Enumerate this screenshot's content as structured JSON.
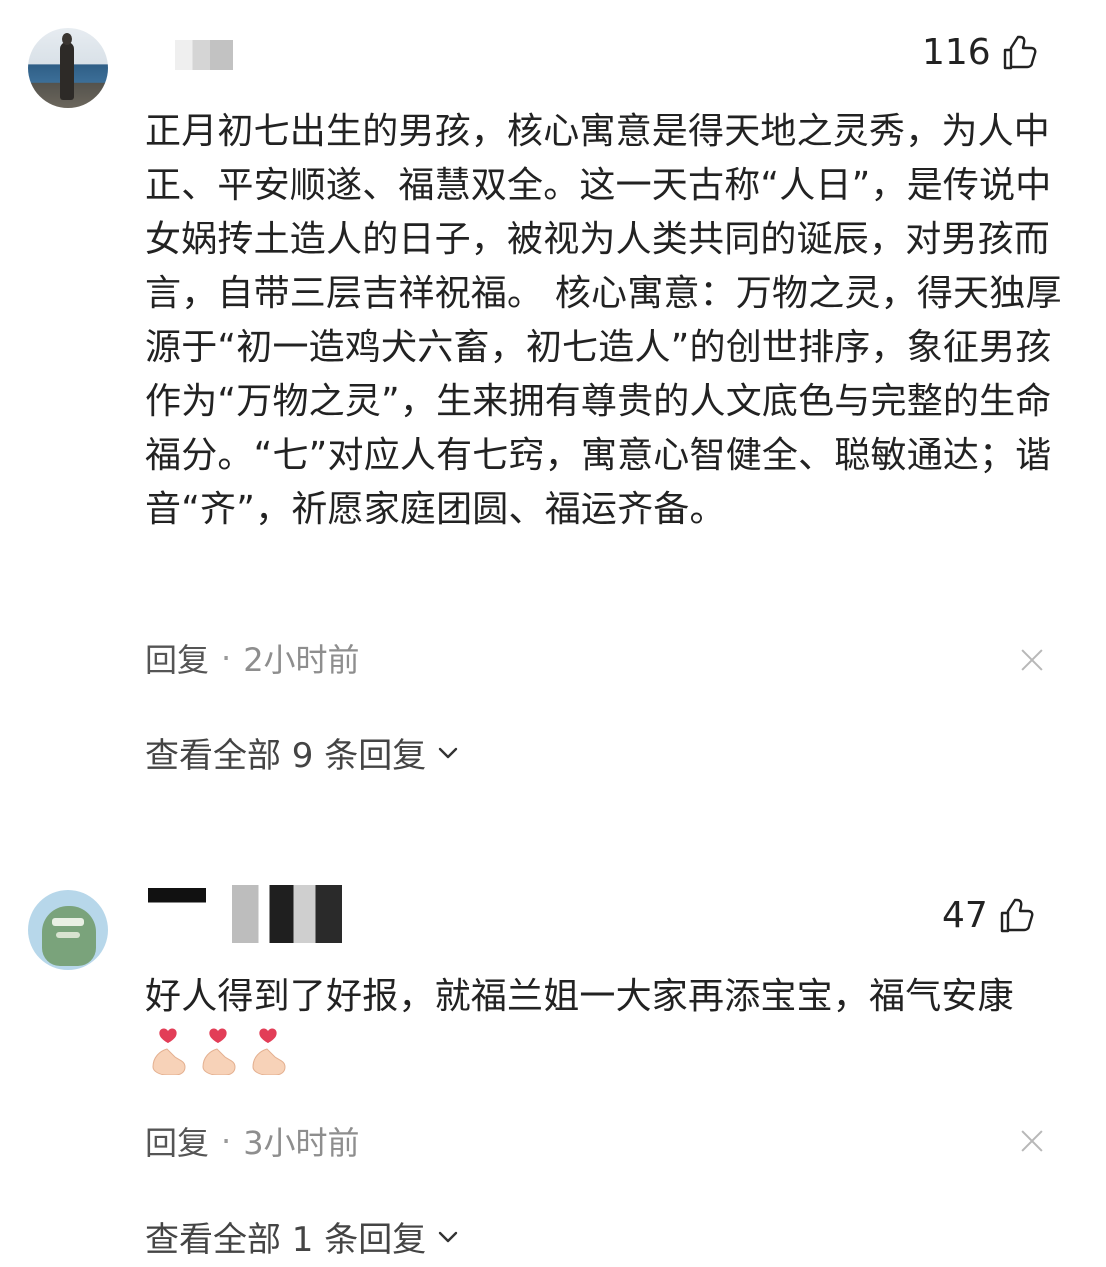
{
  "comments": [
    {
      "likes": "116",
      "text": "正月初七出生的男孩，核心寓意是得天地之灵秀，为人中正、平安顺遂、福慧双全。这一天古称“人日”，是传说中女娲抟土造人的日子，被视为人类共同的诞辰，对男孩而言，自带三层吉祥祝福。 核心寓意：万物之灵，得天独厚 源于“初一造鸡犬六畜，初七造人”的创世排序，象征男孩作为“万物之灵”，生来拥有尊贵的人文底色与完整的生命福分。“七”对应人有七窍，寓意心智健全、聪敏通达；谐音“齐”，祈愿家庭团圆、福运齐备。",
      "reply_label": "回复",
      "separator": "·",
      "time": "2小时前",
      "view_replies": "查看全部 9 条回复",
      "avatar_icon": "avatar-person-icon",
      "like_icon": "thumbs-up-icon",
      "close_icon": "close-icon"
    },
    {
      "likes": "47",
      "text": "好人得到了好报，就福兰姐一大家再添宝宝，福气安康",
      "emoji": [
        "🫰",
        "🫰",
        "🫰"
      ],
      "emoji_icon": "finger-heart-icon",
      "reply_label": "回复",
      "separator": "·",
      "time": "3小时前",
      "view_replies": "查看全部 1 条回复",
      "avatar_icon": "avatar-cartoon-icon",
      "like_icon": "thumbs-up-icon",
      "close_icon": "close-icon"
    }
  ],
  "colors": {
    "text": "#222222",
    "muted": "#8e8e8e",
    "icon": "#222222",
    "close": "#b8b8b8"
  }
}
